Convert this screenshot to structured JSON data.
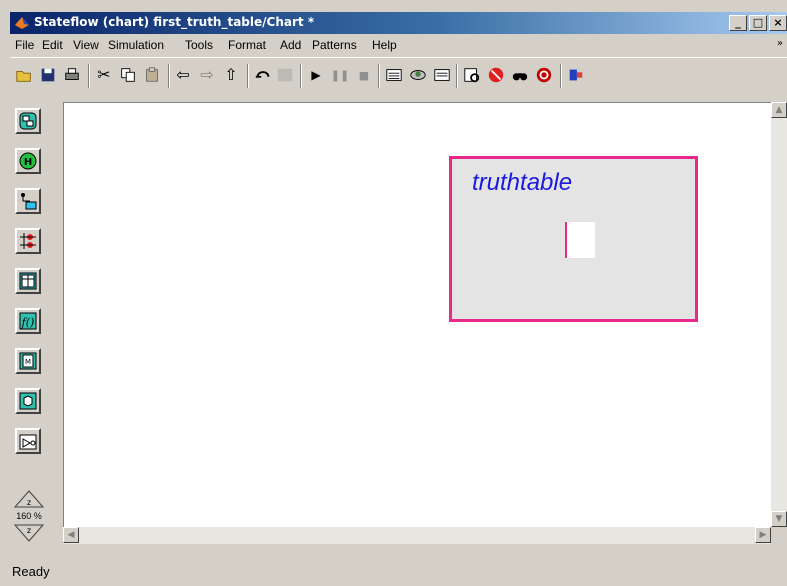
{
  "window": {
    "title": "Stateflow (chart) first_truth_table/Chart *",
    "minimize_glyph": "_",
    "maximize_glyph": "□",
    "close_glyph": "×"
  },
  "menu": {
    "items": [
      {
        "label": "File"
      },
      {
        "label": "Edit"
      },
      {
        "label": "View"
      },
      {
        "label": "Simulation"
      },
      {
        "label": "Tools"
      },
      {
        "label": "Format"
      },
      {
        "label": "Add"
      },
      {
        "label": "Patterns"
      },
      {
        "label": "Help"
      }
    ],
    "more_glyph": "»"
  },
  "toolbar": {
    "icons": [
      "open-icon",
      "save-icon",
      "print-icon",
      "cut-icon",
      "copy-icon",
      "paste-icon",
      "back-icon",
      "forward-icon",
      "up-icon",
      "undo-icon",
      "redo-icon",
      "play-icon",
      "pause-icon",
      "stop-icon",
      "build-icon",
      "target-icon",
      "explorer-icon",
      "debug-icon",
      "stop-debug-icon",
      "find-icon",
      "target-ring-icon",
      "model-icon"
    ]
  },
  "palette": {
    "tools": [
      "state-tool",
      "history-junction-tool",
      "default-transition-tool",
      "connective-junction-tool",
      "truth-table-tool",
      "function-tool",
      "embedded-function-tool",
      "box-tool",
      "simulink-function-tool"
    ],
    "zoom_label": "160 %"
  },
  "chart": {
    "object_label": "truthtable"
  },
  "status": {
    "text": "Ready"
  },
  "colors": {
    "title_gradient_start": "#0a246a",
    "object_border": "#e8288a",
    "object_label": "#1a1adf",
    "object_fill": "#e4e4e4"
  }
}
